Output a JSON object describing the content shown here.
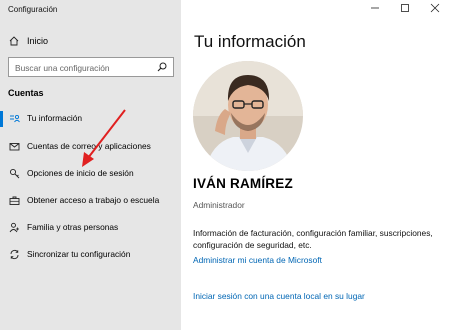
{
  "window": {
    "title": "Configuración"
  },
  "sidebar": {
    "home_label": "Inicio",
    "search_placeholder": "Buscar una configuración",
    "section_title": "Cuentas",
    "items": [
      {
        "label": "Tu información",
        "icon": "user-card-icon",
        "active": true
      },
      {
        "label": "Cuentas de correo y aplicaciones",
        "icon": "mail-icon",
        "active": false
      },
      {
        "label": "Opciones de inicio de sesión",
        "icon": "key-icon",
        "active": false
      },
      {
        "label": "Obtener acceso a trabajo o escuela",
        "icon": "briefcase-icon",
        "active": false
      },
      {
        "label": "Familia y otras personas",
        "icon": "person-add-icon",
        "active": false
      },
      {
        "label": "Sincronizar tu configuración",
        "icon": "sync-icon",
        "active": false
      }
    ]
  },
  "main": {
    "title": "Tu información",
    "user_name": "IVÁN RAMÍREZ",
    "user_role": "Administrador",
    "info_text": "Información de facturación, configuración familiar, suscripciones, configuración de seguridad, etc.",
    "link_manage": "Administrar mi cuenta de Microsoft",
    "link_local": "Iniciar sesión con una cuenta local en su lugar"
  },
  "colors": {
    "accent": "#0078d7",
    "link": "#0066b4",
    "arrow": "#e02020"
  }
}
